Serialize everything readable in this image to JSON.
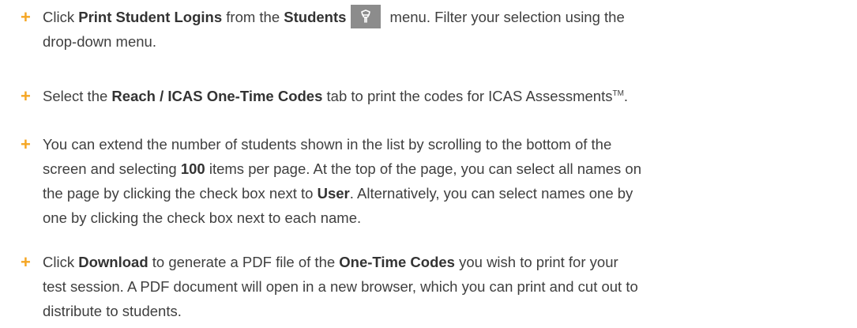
{
  "accent_color": "#f5a623",
  "bullet_symbol": "+",
  "items": [
    {
      "lines": [
        [
          {
            "t": "Click ",
            "b": false
          },
          {
            "t": "Print Student Logins",
            "b": true
          },
          {
            "t": " from the ",
            "b": false
          },
          {
            "t": "Students",
            "b": true
          },
          {
            "icon": "students-menu-icon"
          },
          {
            "t": " menu. Filter your selection using the",
            "b": false
          }
        ],
        [
          {
            "t": "drop-down menu.",
            "b": false
          }
        ]
      ]
    },
    {
      "lines": [
        [
          {
            "t": "Select the ",
            "b": false
          },
          {
            "t": "Reach / ICAS One-Time Codes",
            "b": true
          },
          {
            "t": " tab to print the codes for ICAS Assessments",
            "b": false
          },
          {
            "sup": "TM"
          },
          {
            "t": ".",
            "b": false
          }
        ]
      ]
    },
    {
      "lines": [
        [
          {
            "t": "You can extend the number of students shown in the list by scrolling to the bottom of the",
            "b": false
          }
        ],
        [
          {
            "t": "screen and selecting ",
            "b": false
          },
          {
            "t": "100",
            "b": true
          },
          {
            "t": " items per page. At the top of the page, you can select all names on",
            "b": false
          }
        ],
        [
          {
            "t": "the page by clicking the check box next to ",
            "b": false
          },
          {
            "t": "User",
            "b": true
          },
          {
            "t": ". Alternatively, you can select names one by",
            "b": false
          }
        ],
        [
          {
            "t": "one by clicking the check box next to each name.",
            "b": false
          }
        ]
      ]
    },
    {
      "lines": [
        [
          {
            "t": "Click ",
            "b": false
          },
          {
            "t": "Download",
            "b": true
          },
          {
            "t": " to generate a PDF file of the ",
            "b": false
          },
          {
            "t": "One-Time Codes",
            "b": true
          },
          {
            "t": " you wish to print for your",
            "b": false
          }
        ],
        [
          {
            "t": "test session. A PDF document will open in a new browser, which you can print and cut out to",
            "b": false
          }
        ],
        [
          {
            "t": "distribute to students.",
            "b": false
          }
        ]
      ]
    }
  ]
}
